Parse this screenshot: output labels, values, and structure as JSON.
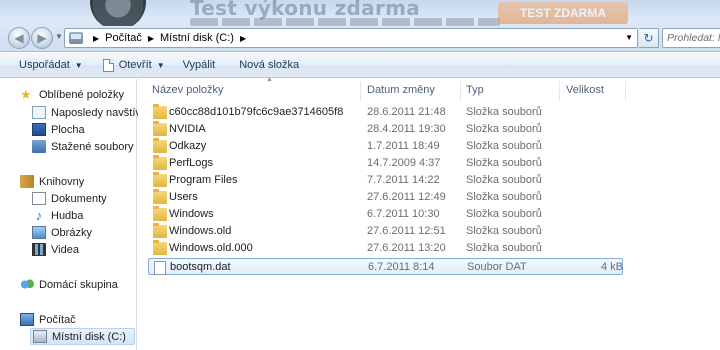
{
  "banner": {
    "title": "Test výkonu zdarma",
    "button": "TEST ZDARMA"
  },
  "address": {
    "crumbs": [
      "Počítač",
      "Místní disk (C:)"
    ],
    "search_placeholder": "Prohledat: Místní disk (C:)"
  },
  "toolbar": {
    "organize": "Uspořádat",
    "open": "Otevřít",
    "burn": "Vypálit",
    "new_folder": "Nová složka"
  },
  "sidebar": {
    "favorites": "Oblíbené položky",
    "recent": "Naposledy navštívené",
    "desktop": "Plocha",
    "downloads": "Stažené soubory",
    "libraries": "Knihovny",
    "documents": "Dokumenty",
    "music": "Hudba",
    "pictures": "Obrázky",
    "videos": "Videa",
    "homegroup": "Domácí skupina",
    "computer": "Počítač",
    "local_disk": "Místní disk (C:)"
  },
  "columns": {
    "name": "Název položky",
    "date": "Datum změny",
    "type": "Typ",
    "size": "Velikost"
  },
  "files": [
    {
      "name": "c60cc88d101b79fc6c9ae3714605f8",
      "date": "28.6.2011 21:48",
      "type": "Složka souborů",
      "size": ""
    },
    {
      "name": "NVIDIA",
      "date": "28.4.2011 19:30",
      "type": "Složka souborů",
      "size": ""
    },
    {
      "name": "Odkazy",
      "date": "1.7.2011 18:49",
      "type": "Složka souborů",
      "size": ""
    },
    {
      "name": "PerfLogs",
      "date": "14.7.2009 4:37",
      "type": "Složka souborů",
      "size": ""
    },
    {
      "name": "Program Files",
      "date": "7.7.2011 14:22",
      "type": "Složka souborů",
      "size": ""
    },
    {
      "name": "Users",
      "date": "27.6.2011 12:49",
      "type": "Složka souborů",
      "size": ""
    },
    {
      "name": "Windows",
      "date": "6.7.2011 10:30",
      "type": "Složka souborů",
      "size": ""
    },
    {
      "name": "Windows.old",
      "date": "27.6.2011 12:51",
      "type": "Složka souborů",
      "size": ""
    },
    {
      "name": "Windows.old.000",
      "date": "27.6.2011 13:20",
      "type": "Složka souborů",
      "size": ""
    },
    {
      "name": "bootsqm.dat",
      "date": "6.7.2011 8:14",
      "type": "Soubor DAT",
      "size": "4 kB"
    }
  ],
  "selected_file": "bootsqm.dat"
}
